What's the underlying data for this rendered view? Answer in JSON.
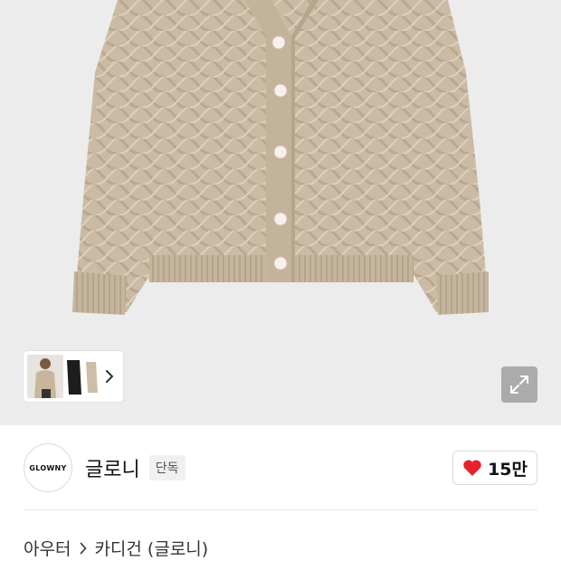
{
  "product": {
    "image_alt_name": "beige cable knit cardigan",
    "expand_icon": "expand-icon"
  },
  "thumbnails": {
    "more_icon": "chevron-right-icon"
  },
  "brand": {
    "logo_text": "GLOWNY",
    "name": "글로니",
    "badge": "단독"
  },
  "like": {
    "icon": "heart-icon",
    "color": "#e8212f",
    "count": "15만"
  },
  "breadcrumb": {
    "category": "아우터",
    "subcategory": "카디건 (글로니)"
  },
  "colors": {
    "image_background": "#ececec",
    "knit": "#cbbba5"
  }
}
